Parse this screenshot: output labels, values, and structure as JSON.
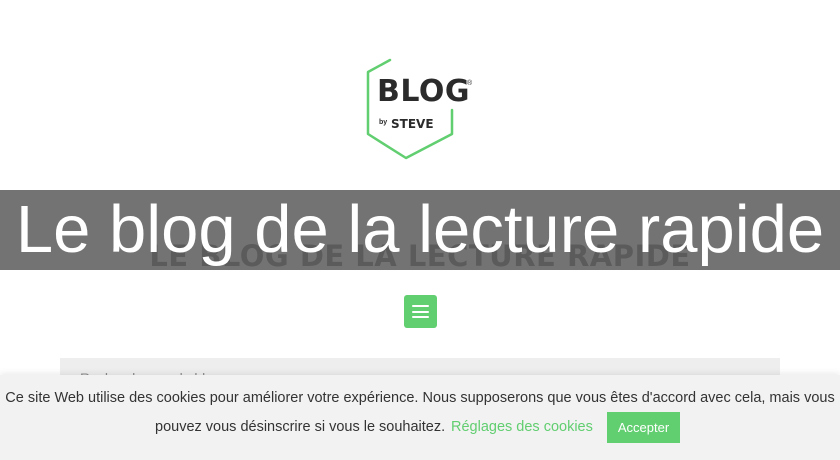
{
  "logo": {
    "blog_text": "BLOG",
    "registered_mark": "®",
    "by_text": "by",
    "author_text": "STEVE",
    "accent_color": "#61ce70"
  },
  "site": {
    "heading": "LE BLOG DE LA LECTURE RAPIDE",
    "overlay_title": "Le blog de la lecture rapide"
  },
  "menu": {
    "icon": "hamburger-icon",
    "color": "#61ce70"
  },
  "search": {
    "placeholder": "Rechercher sur le blog..."
  },
  "cookie_banner": {
    "line1": "Ce site Web utilise des cookies pour améliorer votre expérience. Nous supposerons que vous êtes d'accord avec cela, mais vous",
    "line2": "pouvez vous désinscrire si vous le souhaitez.",
    "settings_label": "Réglages des cookies",
    "accept_label": "Accepter",
    "accent_color": "#61ce70"
  }
}
